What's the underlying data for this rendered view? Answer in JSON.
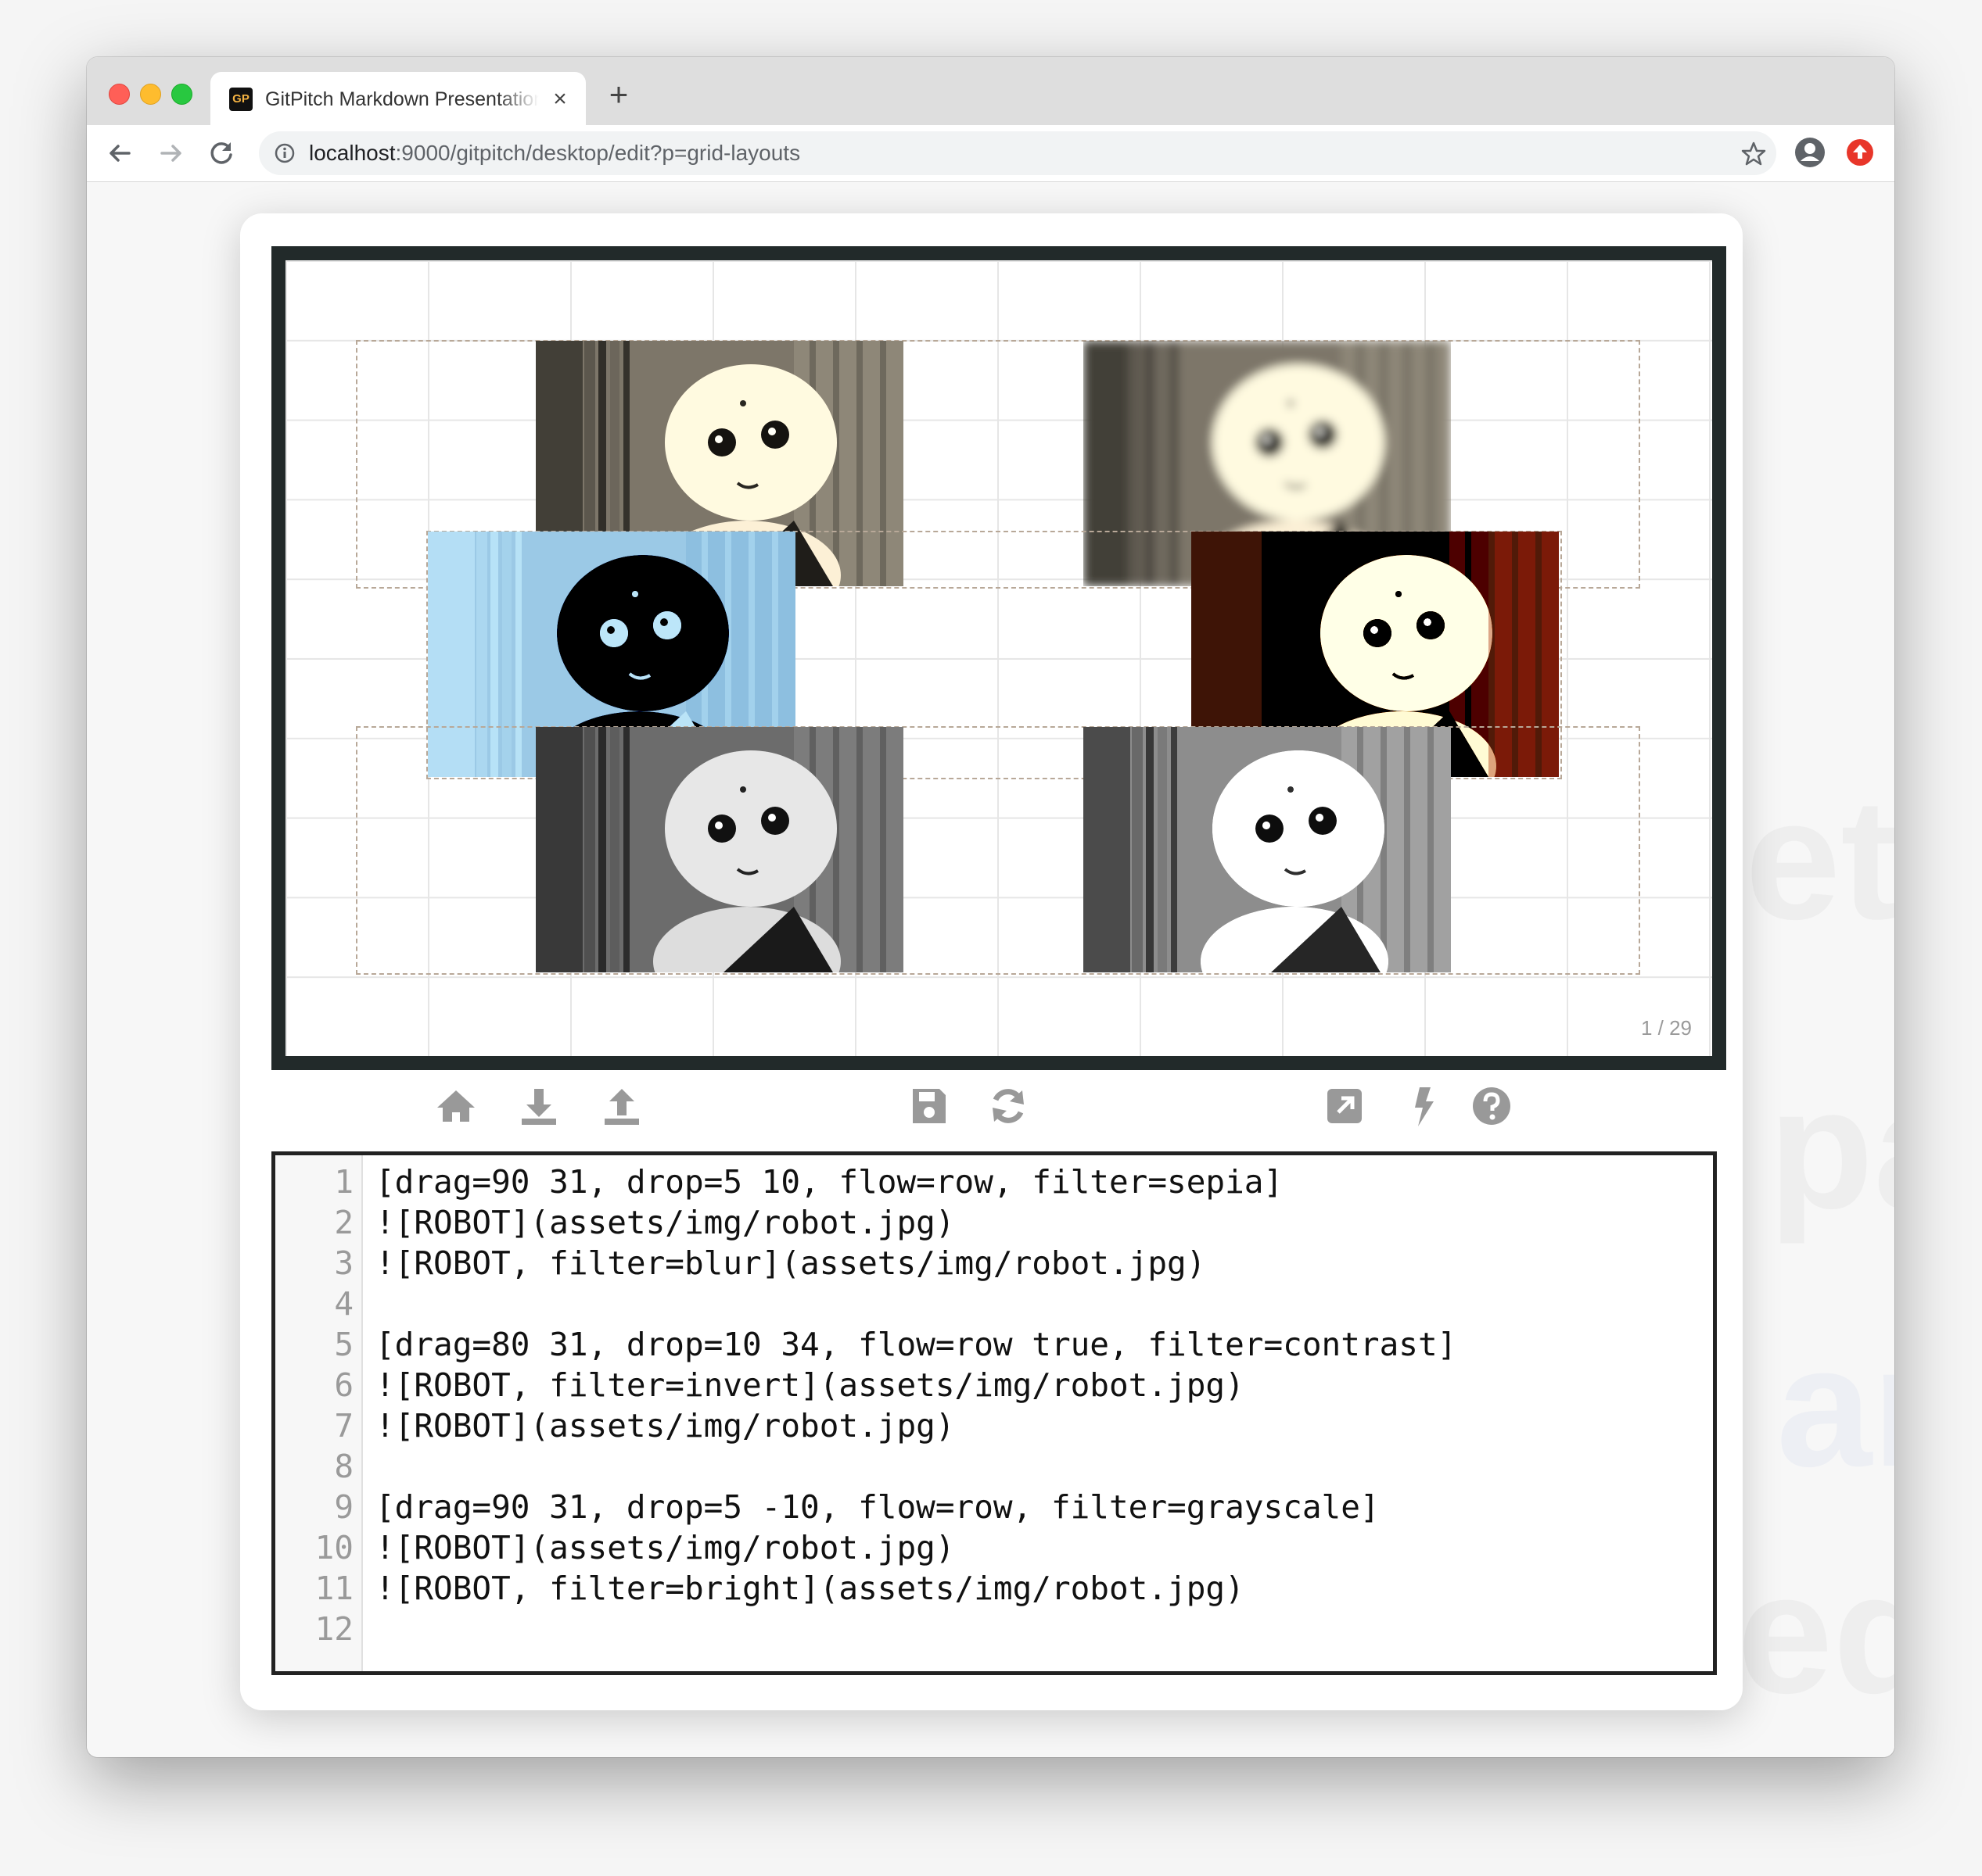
{
  "browser": {
    "tab_title": "GitPitch Markdown Presentation",
    "favicon_text": "GP",
    "tab_close": "×",
    "new_tab": "+",
    "url_host": "localhost",
    "url_rest": ":9000/gitpitch/desktop/edit?p=grid-layouts"
  },
  "slide": {
    "page_indicator": "1 / 29",
    "images": [
      {
        "alt": "ROBOT",
        "filter": "sepia"
      },
      {
        "alt": "ROBOT",
        "filter": "blur"
      },
      {
        "alt": "ROBOT",
        "filter": "invert"
      },
      {
        "alt": "ROBOT",
        "filter": "contrast"
      },
      {
        "alt": "ROBOT",
        "filter": "grayscale"
      },
      {
        "alt": "ROBOT",
        "filter": "bright"
      }
    ]
  },
  "controls": [
    "home-icon",
    "download-icon",
    "upload-icon",
    "save-icon",
    "refresh-icon",
    "external-link-icon",
    "lightning-icon",
    "help-icon"
  ],
  "editor": {
    "lines": [
      {
        "n": "1",
        "text": "[drag=90 31, drop=5 10, flow=row, filter=sepia]"
      },
      {
        "n": "2",
        "text": "![ROBOT](assets/img/robot.jpg)"
      },
      {
        "n": "3",
        "text": "![ROBOT, filter=blur](assets/img/robot.jpg)"
      },
      {
        "n": "4",
        "text": ""
      },
      {
        "n": "5",
        "text": "[drag=80 31, drop=10 34, flow=row true, filter=contrast]"
      },
      {
        "n": "6",
        "text": "![ROBOT, filter=invert](assets/img/robot.jpg)"
      },
      {
        "n": "7",
        "text": "![ROBOT](assets/img/robot.jpg)"
      },
      {
        "n": "8",
        "text": ""
      },
      {
        "n": "9",
        "text": "[drag=90 31, drop=5 -10, flow=row, filter=grayscale]"
      },
      {
        "n": "10",
        "text": "![ROBOT](assets/img/robot.jpg)"
      },
      {
        "n": "11",
        "text": "![ROBOT, filter=bright](assets/img/robot.jpg)"
      },
      {
        "n": "12",
        "text": ""
      }
    ]
  },
  "colors": {
    "frame": "#222a2a",
    "sepia": "#a08a68",
    "invert_accent": "#3fb6ee",
    "contrast_accent": "#b33a12"
  }
}
